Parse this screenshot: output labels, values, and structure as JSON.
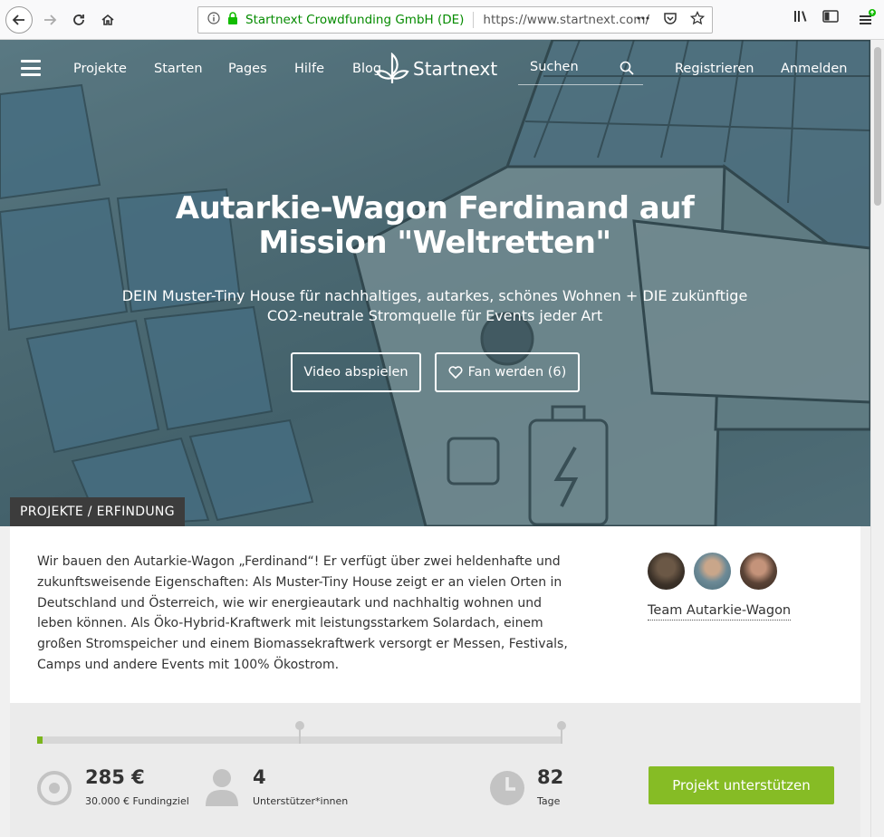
{
  "browser": {
    "org_name": "Startnext Crowdfunding GmbH (DE)",
    "url": "https://www.startnext.com/",
    "more_icon": "ellipsis-icon",
    "pocket_icon": "pocket-icon",
    "bookmark_icon": "star-icon"
  },
  "nav": {
    "items": [
      "Projekte",
      "Starten",
      "Pages",
      "Hilfe",
      "Blog"
    ],
    "logo_text": "Startnext",
    "search_label": "Suchen",
    "register": "Registrieren",
    "login": "Anmelden"
  },
  "hero": {
    "title": "Autarkie-Wagon Ferdinand auf Mission \"Weltretten\"",
    "subtitle": "DEIN Muster-Tiny House für nachhaltiges, autarkes, schönes Wohnen + DIE zukünftige CO2-neutrale Stromquelle für Events jeder Art",
    "video_button": "Video abspielen",
    "fan_button": "Fan werden (6)"
  },
  "category": "PROJEKTE / ERFINDUNG",
  "description": "Wir bauen den Autarkie-Wagon „Ferdinand“! Er verfügt über zwei heldenhafte und zukunftsweisende Eigenschaften: Als Muster-Tiny House zeigt er an vielen Orten in Deutschland und Österreich, wie wir energieautark und nachhaltig wohnen und leben können. Als Öko-Hybrid-Kraftwerk mit leistungsstarkem Solardach, einem großen Stromspeicher und einem Biomassekraftwerk versorgt er Messen, Festivals, Camps und andere Events mit 100% Ökostrom.",
  "team": {
    "name": "Team Autarkie-Wagon"
  },
  "stats": {
    "progress_fraction": 0.0095,
    "funding_value": "285 €",
    "funding_label": "30.000 € Fundingziel",
    "supporters_value": "4",
    "supporters_label": "Unterstützer*innen",
    "days_value": "82",
    "days_label": "Tage",
    "support_button": "Projekt unterstützen"
  },
  "colors": {
    "accent_green": "#86bc25",
    "progress_green": "#7bb51d",
    "category_bg": "#3c3c3c"
  }
}
